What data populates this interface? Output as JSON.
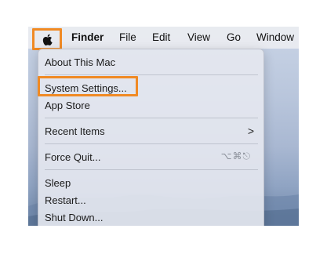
{
  "menubar": {
    "apple_icon": "apple-logo-icon",
    "items": [
      "Finder",
      "File",
      "Edit",
      "View",
      "Go",
      "Window"
    ]
  },
  "apple_menu": {
    "about": "About This Mac",
    "system_settings": "System Settings...",
    "app_store": "App Store",
    "recent_items": "Recent Items",
    "recent_items_arrow": ">",
    "force_quit": "Force Quit...",
    "force_quit_shortcut": "⌥⌘⎋",
    "sleep": "Sleep",
    "restart": "Restart...",
    "shut_down": "Shut Down..."
  },
  "highlight_color": "#f08a24"
}
